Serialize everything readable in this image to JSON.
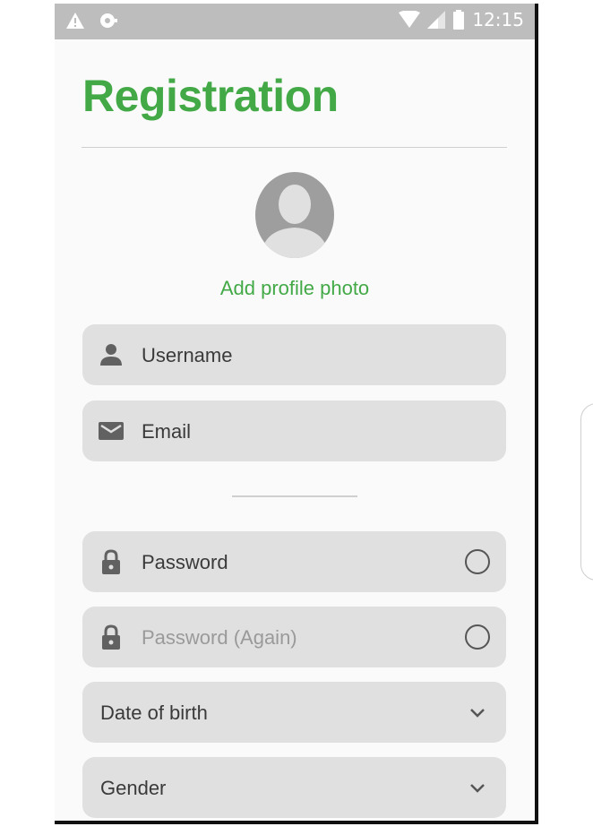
{
  "status_bar": {
    "time": "12:15",
    "icons": [
      "warning-icon",
      "notification-icon",
      "wifi-icon",
      "signal-icon",
      "battery-icon"
    ]
  },
  "page": {
    "title": "Registration"
  },
  "profile": {
    "add_photo_label": "Add profile photo",
    "avatar_icon": "avatar-icon"
  },
  "fields": {
    "username": {
      "placeholder": "Username",
      "icon": "person-icon"
    },
    "email": {
      "placeholder": "Email",
      "icon": "envelope-icon"
    },
    "password": {
      "placeholder": "Password",
      "icon": "lock-icon"
    },
    "password_again": {
      "placeholder": "Password (Again)",
      "icon": "lock-icon"
    },
    "date_of_birth": {
      "label": "Date of birth",
      "icon": "chevron-down-icon"
    },
    "gender": {
      "label": "Gender",
      "icon": "chevron-down-icon"
    }
  },
  "colors": {
    "accent": "#43a947",
    "field_bg": "#e0e0e0",
    "status_bar": "#bdbdbd",
    "background": "#fafafa"
  }
}
